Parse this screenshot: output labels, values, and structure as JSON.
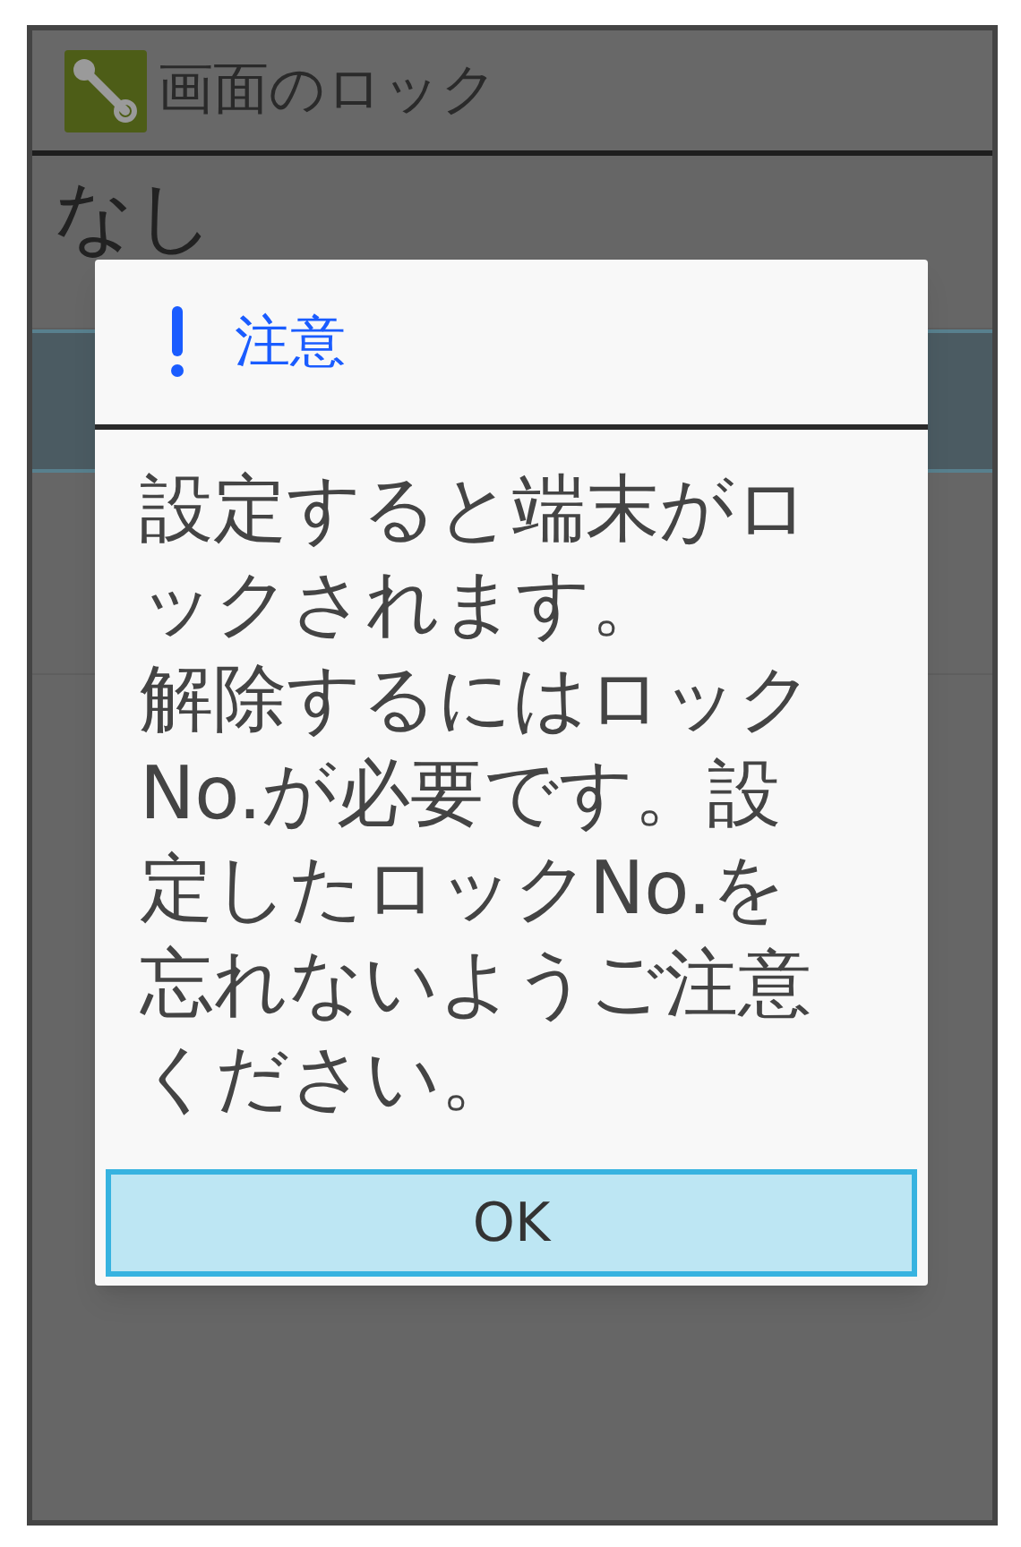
{
  "header": {
    "title": "画面のロック"
  },
  "list": [
    {
      "label": "なし",
      "selected": false
    },
    {
      "selected": true
    },
    {
      "selected": false
    }
  ],
  "dialog": {
    "title": "注意",
    "message": [
      "設定すると端末がロックされます。",
      "解除するにはロックNo.が必要です。設定したロックNo.を忘れないようご注意ください。"
    ],
    "button": "OK"
  }
}
